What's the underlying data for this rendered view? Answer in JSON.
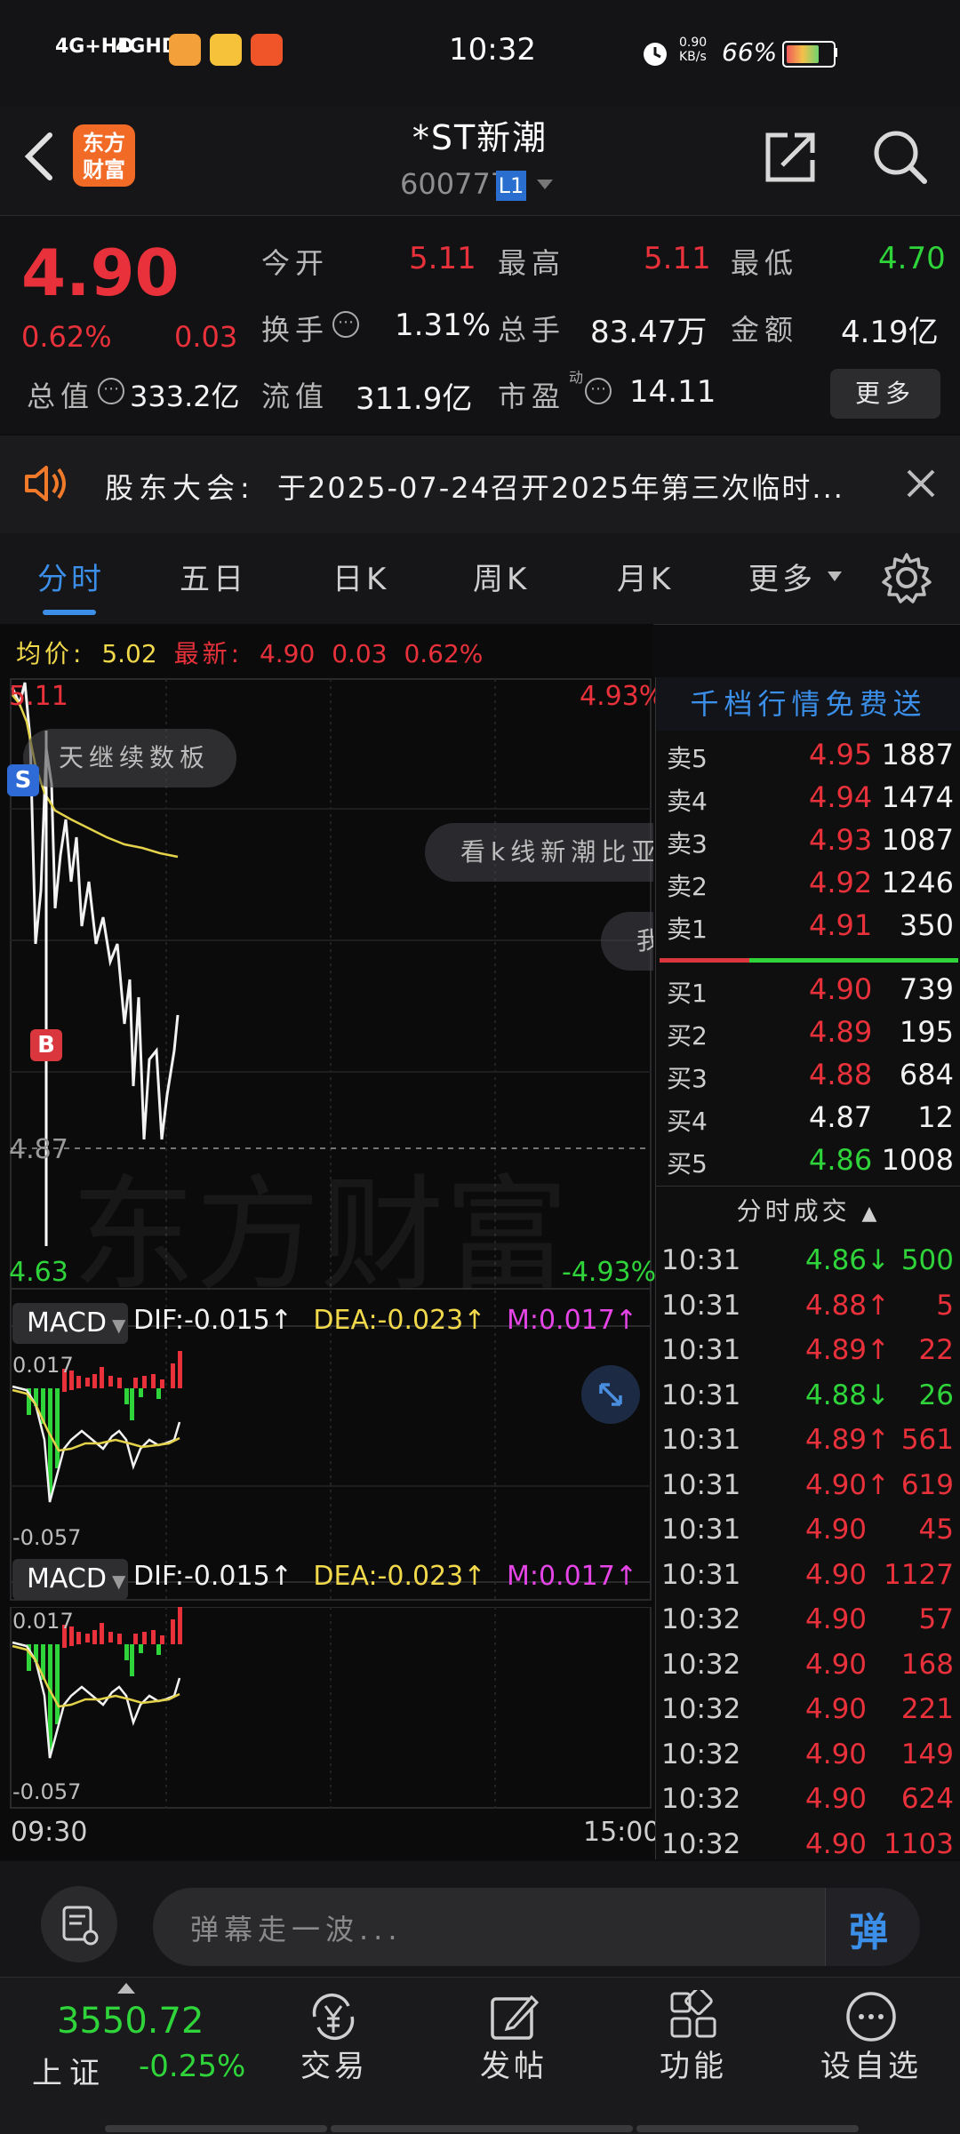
{
  "status_bar": {
    "network1": "4G+HD",
    "network2": "4GHD",
    "time": "10:32",
    "speed_value": "0.90",
    "speed_unit": "KB/s",
    "battery": "66%"
  },
  "header": {
    "logo_line1": "东方",
    "logo_line2": "财富",
    "stock_name": "*ST新潮",
    "stock_code": "600777",
    "level_badge": "L1"
  },
  "quote": {
    "price": "4.90",
    "change_pct": "0.62%",
    "change_amt": "0.03",
    "open_label": "今开",
    "open": "5.11",
    "high_label": "最高",
    "high": "5.11",
    "low_label": "最低",
    "low": "4.70",
    "turnover_label": "换手",
    "turnover": "1.31%",
    "volume_label": "总手",
    "volume": "83.47万",
    "amount_label": "金额",
    "amount": "4.19亿",
    "mktcap_label": "总值",
    "mktcap": "333.2亿",
    "float_label": "流值",
    "float_cap": "311.9亿",
    "pe_label": "市盈",
    "pe_sup": "动",
    "pe": "14.11",
    "more_button": "更多"
  },
  "notice": {
    "label": "股东大会:",
    "text": "于2025-07-24召开2025年第三次临时..."
  },
  "tabs": [
    "分时",
    "五日",
    "日K",
    "周K",
    "月K",
    "更多"
  ],
  "chart": {
    "avg_label": "均价:",
    "avg": "5.02",
    "latest_label": "最新:",
    "latest": "4.90",
    "latest_chg": "0.03",
    "latest_pct": "0.62%",
    "y_top": "5.11",
    "y_top_pct": "4.93%",
    "y_mid": "4.87",
    "y_bottom": "4.63",
    "y_bottom_pct": "-4.93%",
    "bubble1": "天继续数板",
    "bubble2": "看k线新潮比亚",
    "bubble3": "我",
    "watermark": "东方财富",
    "marker_s": "S",
    "marker_b": "B",
    "time_start": "09:30",
    "time_end": "15:00",
    "macd": [
      {
        "label": "MACD",
        "dif": "DIF:-0.015",
        "dea": "DEA:-0.023",
        "m": "M:0.017",
        "top": "0.017",
        "bottom": "-0.057"
      },
      {
        "label": "MACD",
        "dif": "DIF:-0.015",
        "dea": "DEA:-0.023",
        "m": "M:0.017",
        "top": "0.017",
        "bottom": "-0.057"
      }
    ]
  },
  "orderbook": {
    "promo": "千档行情免费送",
    "asks": [
      {
        "label": "卖5",
        "price": "4.95",
        "qty": "1887"
      },
      {
        "label": "卖4",
        "price": "4.94",
        "qty": "1474"
      },
      {
        "label": "卖3",
        "price": "4.93",
        "qty": "1087"
      },
      {
        "label": "卖2",
        "price": "4.92",
        "qty": "1246"
      },
      {
        "label": "卖1",
        "price": "4.91",
        "qty": "350"
      }
    ],
    "bids": [
      {
        "label": "买1",
        "price": "4.90",
        "qty": "739"
      },
      {
        "label": "买2",
        "price": "4.89",
        "qty": "195"
      },
      {
        "label": "买3",
        "price": "4.88",
        "qty": "684"
      },
      {
        "label": "买4",
        "price": "4.87",
        "qty": "12"
      },
      {
        "label": "买5",
        "price": "4.86",
        "qty": "1008"
      }
    ],
    "trades_header": "分时成交",
    "trades": [
      {
        "time": "10:31",
        "price": "4.86↓",
        "qty": "500",
        "color": "green"
      },
      {
        "time": "10:31",
        "price": "4.88↑",
        "qty": "5",
        "color": "red"
      },
      {
        "time": "10:31",
        "price": "4.89↑",
        "qty": "22",
        "color": "red"
      },
      {
        "time": "10:31",
        "price": "4.88↓",
        "qty": "26",
        "color": "green"
      },
      {
        "time": "10:31",
        "price": "4.89↑",
        "qty": "561",
        "color": "red"
      },
      {
        "time": "10:31",
        "price": "4.90↑",
        "qty": "619",
        "color": "red"
      },
      {
        "time": "10:31",
        "price": "4.90",
        "qty": "45",
        "color": "red"
      },
      {
        "time": "10:31",
        "price": "4.90",
        "qty": "1127",
        "color": "red"
      },
      {
        "time": "10:32",
        "price": "4.90",
        "qty": "57",
        "color": "red"
      },
      {
        "time": "10:32",
        "price": "4.90",
        "qty": "168",
        "color": "red"
      },
      {
        "time": "10:32",
        "price": "4.90",
        "qty": "221",
        "color": "red"
      },
      {
        "time": "10:32",
        "price": "4.90",
        "qty": "149",
        "color": "red"
      },
      {
        "time": "10:32",
        "price": "4.90",
        "qty": "624",
        "color": "red"
      },
      {
        "time": "10:32",
        "price": "4.90",
        "qty": "1103",
        "color": "red"
      }
    ]
  },
  "input": {
    "placeholder": "弹幕走一波...",
    "danmu_button": "弹"
  },
  "bottom_nav": {
    "index_value": "3550.72",
    "index_name": "上证",
    "index_change": "-0.25%",
    "items": [
      "交易",
      "发帖",
      "功能",
      "设自选"
    ]
  }
}
